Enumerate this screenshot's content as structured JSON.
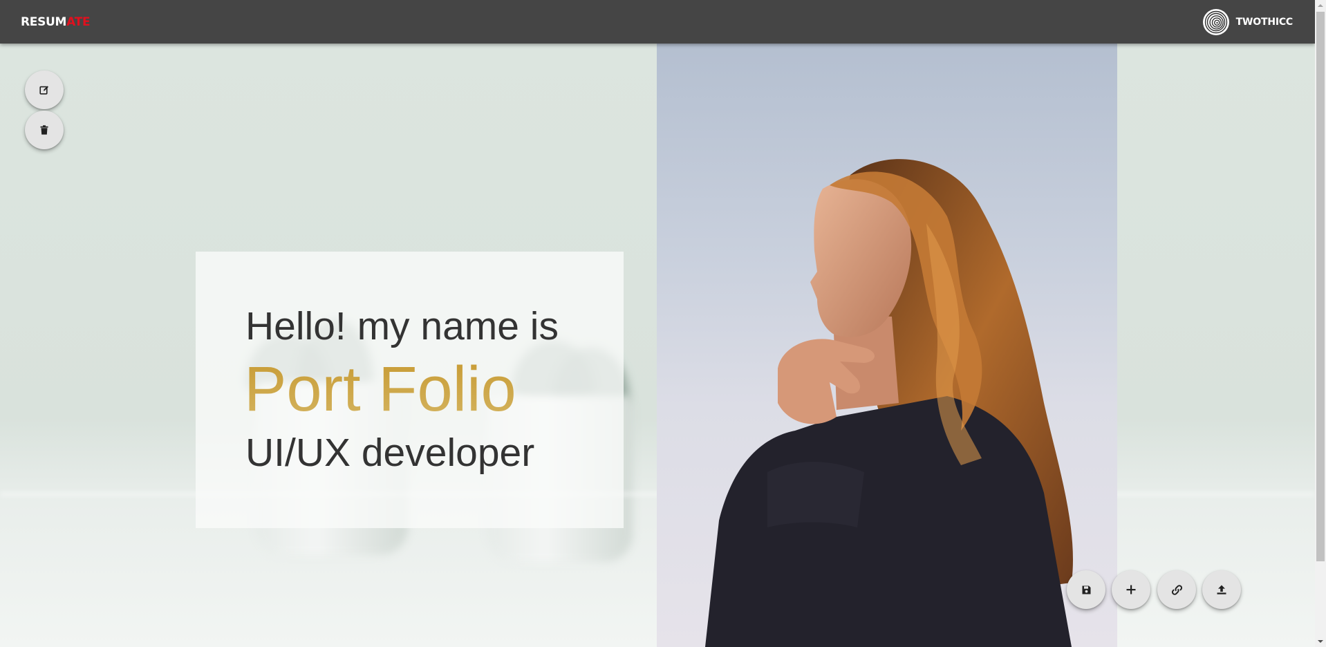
{
  "header": {
    "brand": [
      "RESUM",
      "ATE"
    ],
    "username": "TWOTHICC",
    "brand_color": "#e0101e"
  },
  "intro": {
    "greeting": "Hello! my name is",
    "name": "Port Folio",
    "role": "UI/UX developer",
    "accent_color": "#c9a24a"
  },
  "actions": {
    "top_left": [
      "edit-icon",
      "trash-icon"
    ],
    "bottom_right": [
      "save-icon",
      "plus-icon",
      "link-icon",
      "upload-icon"
    ]
  }
}
